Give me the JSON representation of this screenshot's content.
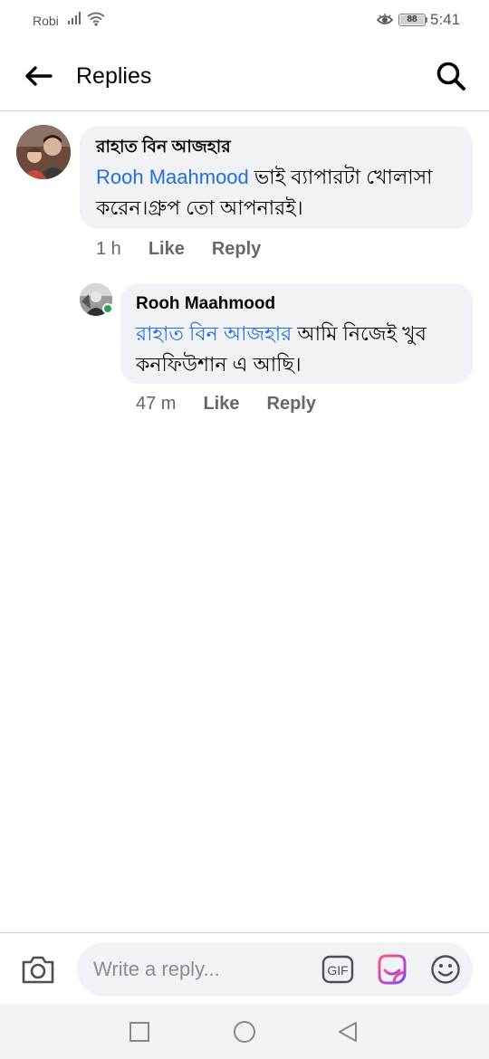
{
  "status_bar": {
    "carrier": "Robi",
    "battery": "88",
    "time": "5:41"
  },
  "header": {
    "title": "Replies"
  },
  "comments": [
    {
      "author": "রাহাত বিন আজহার",
      "mention": "Rooh Maahmood",
      "text": " ভাই ব্যাপারটা খোলাসা করেন।গ্রুপ তো আপনারই।",
      "time": "1 h",
      "like_label": "Like",
      "reply_label": "Reply"
    },
    {
      "author": "Rooh Maahmood",
      "mention": "রাহাত বিন আজহার",
      "text": " আমি নিজেই খুব কনফিউশান এ আছি।",
      "time": "47 m",
      "like_label": "Like",
      "reply_label": "Reply",
      "online": true
    }
  ],
  "composer": {
    "placeholder": "Write a reply...",
    "gif_label": "GIF"
  },
  "icons": {
    "back": "arrow-left-icon",
    "search": "search-icon",
    "camera": "camera-icon",
    "gif": "gif-icon",
    "sticker": "sticker-icon",
    "emoji": "emoji-icon"
  },
  "colors": {
    "mention": "#216fdb",
    "bubble": "#f0f2f5",
    "online": "#31a24c",
    "meta": "#65676b"
  }
}
